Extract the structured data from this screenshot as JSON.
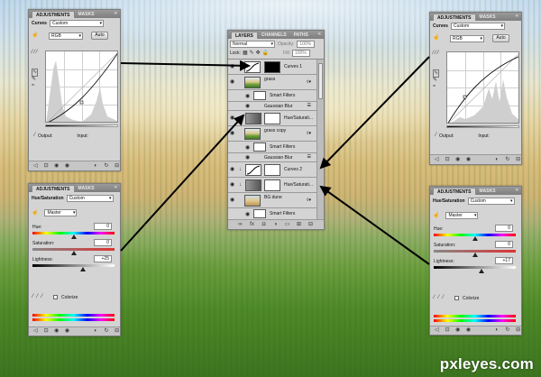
{
  "curves_left": {
    "tabs": [
      "ADJUSTMENTS",
      "MASKS"
    ],
    "title": "Curves",
    "preset": "Custom",
    "channel": "RGB",
    "auto_label": "Auto",
    "output_label": "Output:",
    "input_label": "Input:"
  },
  "curves_right": {
    "tabs": [
      "ADJUSTMENTS",
      "MASKS"
    ],
    "title": "Curves",
    "preset": "Custom",
    "channel": "RGB",
    "auto_label": "Auto",
    "output_label": "Output:",
    "input_label": "Input:"
  },
  "hue_left": {
    "tabs": [
      "ADJUSTMENTS",
      "MASKS"
    ],
    "title": "Hue/Saturation",
    "preset": "Custom",
    "range": "Master",
    "hue_label": "Hue:",
    "hue_value": "0",
    "saturation_label": "Saturation:",
    "saturation_value": "0",
    "lightness_label": "Lightness:",
    "lightness_value": "+25",
    "colorize_label": "Colorize"
  },
  "hue_right": {
    "tabs": [
      "ADJUSTMENTS",
      "MASKS"
    ],
    "title": "Hue/Saturation",
    "preset": "Custom",
    "range": "Master",
    "hue_label": "Hue:",
    "hue_value": "0",
    "saturation_label": "Saturation:",
    "saturation_value": "0",
    "lightness_label": "Lightness:",
    "lightness_value": "+17",
    "colorize_label": "Colorize"
  },
  "layers": {
    "tabs": [
      "LAYERS",
      "CHANNELS",
      "PATHS"
    ],
    "blend_mode": "Normal",
    "opacity_label": "Opacity:",
    "opacity_value": "100%",
    "fill_label": "Fill:",
    "fill_value": "100%",
    "lock_label": "Lock:",
    "items": [
      {
        "name": "Curves 1",
        "kind": "adjustment"
      },
      {
        "name": "grass",
        "kind": "smart"
      },
      {
        "name": "Smart Filters",
        "kind": "filters"
      },
      {
        "name": "Gaussian Blur",
        "kind": "filter"
      },
      {
        "name": "Hue/Saturati...",
        "kind": "adjustment"
      },
      {
        "name": "grass copy",
        "kind": "smart"
      },
      {
        "name": "Smart Filters",
        "kind": "filters"
      },
      {
        "name": "Gaussian Blur",
        "kind": "filter"
      },
      {
        "name": "Curves 2",
        "kind": "adjustment"
      },
      {
        "name": "Hue/Saturati...",
        "kind": "adjustment"
      },
      {
        "name": "BG dune",
        "kind": "smart"
      },
      {
        "name": "Smart Filters",
        "kind": "filters"
      }
    ]
  },
  "watermark": "pxleyes.com",
  "colors": {
    "panel": "#d4d4d4",
    "tab_bar": "#8a8a8a",
    "arrow": "#000000"
  }
}
